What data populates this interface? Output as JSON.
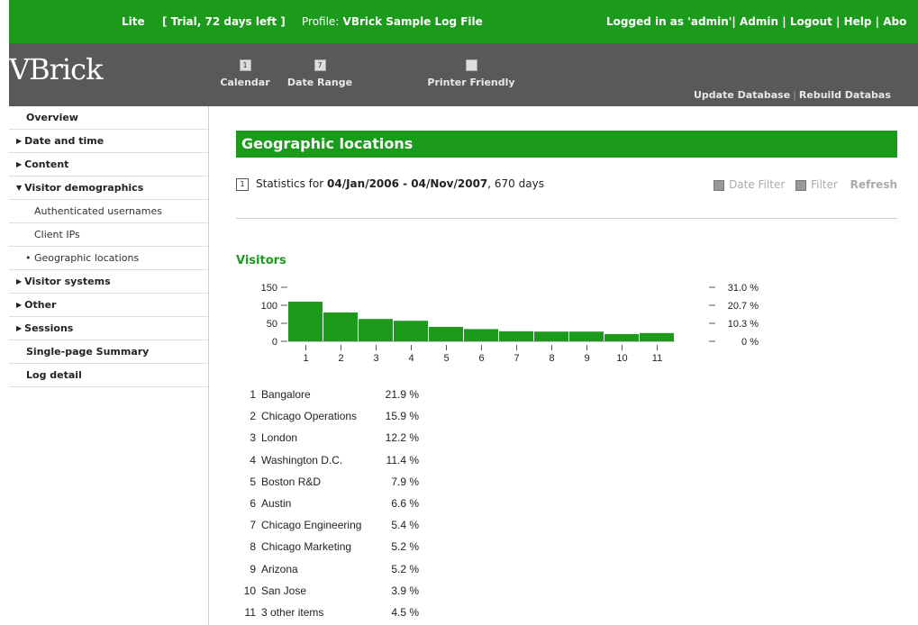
{
  "topbar": {
    "edition": "Lite",
    "trial": "[ Trial, 72 days left ]",
    "profile_prefix": "Profile:",
    "profile_name": "VBrick Sample Log File",
    "logged_in": "Logged in as 'admin'|",
    "admin": "Admin",
    "logout": "Logout",
    "help": "Help",
    "about": "Abo",
    "sep": "|"
  },
  "header": {
    "logo": "VBrick",
    "tools": [
      {
        "label": "Calendar",
        "icon": "calendar-icon",
        "glyph": "1"
      },
      {
        "label": "Date Range",
        "icon": "date-range-icon",
        "glyph": "7"
      },
      {
        "label": "Printer Friendly",
        "icon": "printer-icon",
        "glyph": ""
      }
    ],
    "update_db": "Update Database",
    "rebuild_db": "Rebuild Databas"
  },
  "sidebar": {
    "items": [
      {
        "label": "Overview"
      },
      {
        "label": "Date and time",
        "triangle": "▶"
      },
      {
        "label": "Content",
        "triangle": "▶"
      },
      {
        "label": "Visitor demographics",
        "triangle": "▼"
      },
      {
        "label": "Authenticated usernames"
      },
      {
        "label": "Client IPs"
      },
      {
        "label": "Geographic locations",
        "bullet": "•"
      },
      {
        "label": "Visitor systems",
        "triangle": "▶"
      },
      {
        "label": "Other",
        "triangle": "▶"
      },
      {
        "label": "Sessions",
        "triangle": "▶"
      },
      {
        "label": "Single-page Summary"
      },
      {
        "label": "Log detail"
      }
    ]
  },
  "main": {
    "title": "Geographic locations",
    "stats_prefix": "Statistics for",
    "stats_range": "04/Jan/2006 - 04/Nov/2007",
    "stats_suffix": ", 670 days",
    "calendar_glyph": "1",
    "date_filter": "Date Filter",
    "filter": "Filter",
    "refresh": "Refresh"
  },
  "colors": {
    "accent": "#1c9a1c",
    "header_bg": "#595959"
  },
  "chart_data": {
    "type": "bar",
    "title": "Visitors",
    "categories": [
      "1",
      "2",
      "3",
      "4",
      "5",
      "6",
      "7",
      "8",
      "9",
      "10",
      "11"
    ],
    "values": [
      110,
      80,
      62,
      57,
      40,
      34,
      28,
      27,
      27,
      20,
      23
    ],
    "ylim": [
      0,
      150
    ],
    "y_ticks": [
      "150",
      "100",
      "50",
      "0"
    ],
    "y_tick_values": [
      150,
      100,
      50,
      0
    ],
    "right_ticks": [
      "31.0 %",
      "20.7 %",
      "10.3 %",
      "0 %"
    ],
    "right_tick_values": [
      150,
      100,
      50,
      0
    ],
    "color": "#1c9a1c"
  },
  "table": {
    "rows": [
      {
        "n": "1",
        "label": "Bangalore",
        "pct": "21.9 %"
      },
      {
        "n": "2",
        "label": "Chicago Operations",
        "pct": "15.9 %"
      },
      {
        "n": "3",
        "label": "London",
        "pct": "12.2 %"
      },
      {
        "n": "4",
        "label": "Washington D.C.",
        "pct": "11.4 %"
      },
      {
        "n": "5",
        "label": "Boston R&D",
        "pct": "7.9 %"
      },
      {
        "n": "6",
        "label": "Austin",
        "pct": "6.6 %"
      },
      {
        "n": "7",
        "label": "Chicago Engineering",
        "pct": "5.4 %"
      },
      {
        "n": "8",
        "label": "Chicago Marketing",
        "pct": "5.2 %"
      },
      {
        "n": "9",
        "label": "Arizona",
        "pct": "5.2 %"
      },
      {
        "n": "10",
        "label": "San Jose",
        "pct": "3.9 %"
      },
      {
        "n": "11",
        "label": "3 other items",
        "pct": "4.5 %"
      }
    ]
  }
}
